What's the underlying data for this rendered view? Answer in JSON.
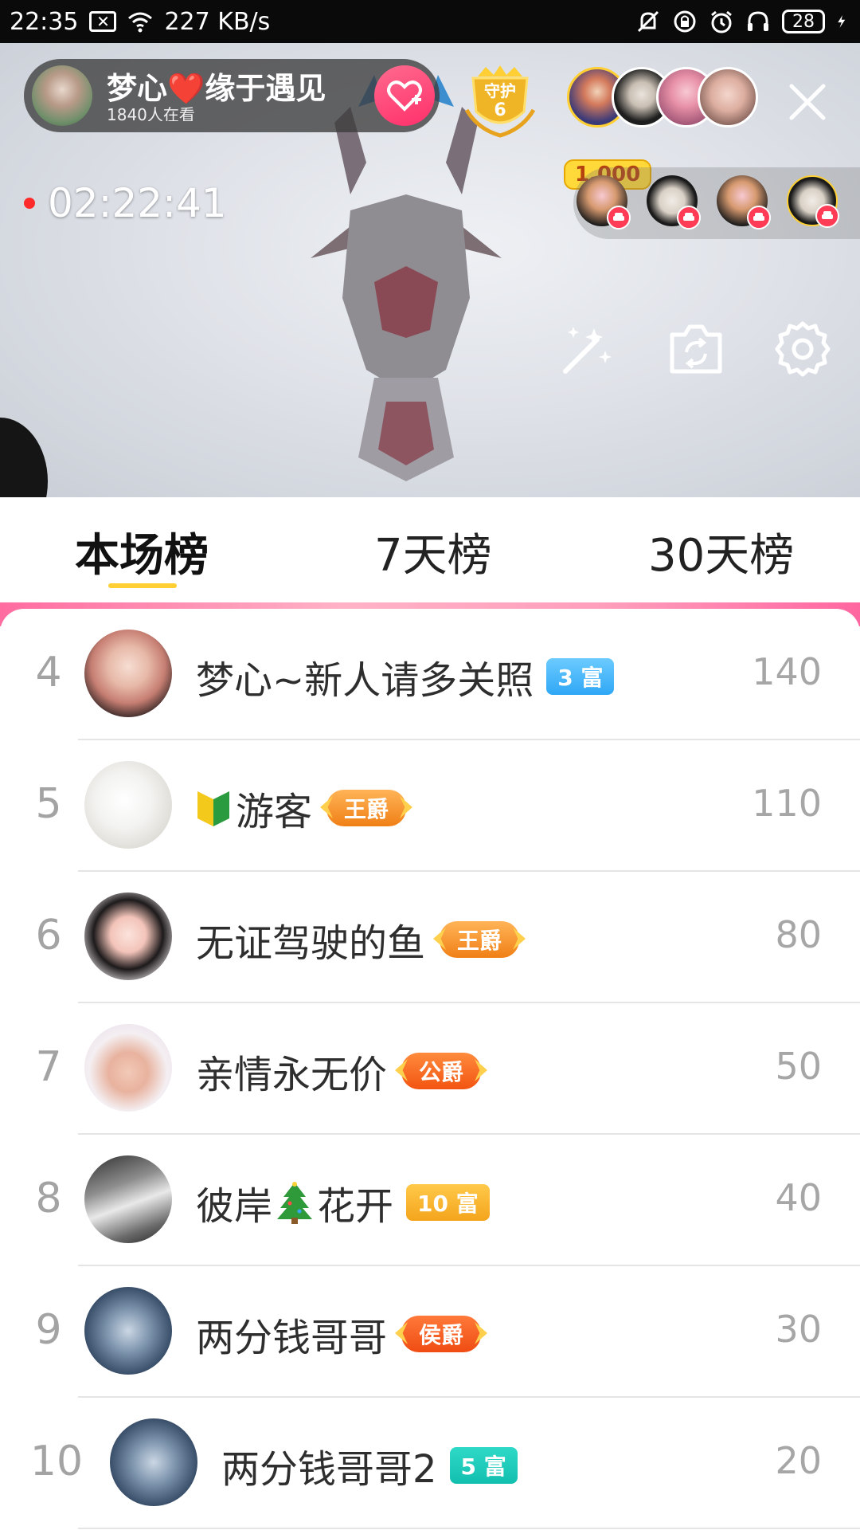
{
  "status_bar": {
    "time": "22:35",
    "net_speed": "227 KB/s",
    "battery": "28"
  },
  "live": {
    "host_name": "梦心❤️缘于遇见",
    "watching": "1840人在看",
    "guard_label": "守护",
    "guard_count": "6",
    "top_contribution": "1,000",
    "timer": "02:22:41"
  },
  "tabs": [
    {
      "label": "本场榜",
      "active": true
    },
    {
      "label": "7天榜",
      "active": false
    },
    {
      "label": "30天榜",
      "active": false
    }
  ],
  "rows": [
    {
      "rank": "4",
      "name": "梦心~新人请多关照",
      "badge": "3 富",
      "badge_type": "rich-blue",
      "score": "140"
    },
    {
      "rank": "5",
      "name": "游客",
      "badge": "王爵",
      "badge_type": "noble",
      "score": "110"
    },
    {
      "rank": "6",
      "name": "无证驾驶的鱼",
      "badge": "王爵",
      "badge_type": "noble",
      "score": "80"
    },
    {
      "rank": "7",
      "name": "亲情永无价",
      "badge": "公爵",
      "badge_type": "noble gong",
      "score": "50"
    },
    {
      "rank": "8",
      "name_before": "彼岸",
      "name_after": "花开",
      "badge": "10 富",
      "badge_type": "rich-orange",
      "score": "40"
    },
    {
      "rank": "9",
      "name": "两分钱哥哥",
      "badge": "侯爵",
      "badge_type": "noble hou",
      "score": "30"
    },
    {
      "rank": "10",
      "name": "两分钱哥哥2",
      "badge": "5 富",
      "badge_type": "rich-teal",
      "score": "20"
    }
  ],
  "colors": {
    "accent_yellow": "#ffcf33",
    "follow_pink": "#ff2f6b",
    "rank_gray": "#a3a3a3"
  }
}
